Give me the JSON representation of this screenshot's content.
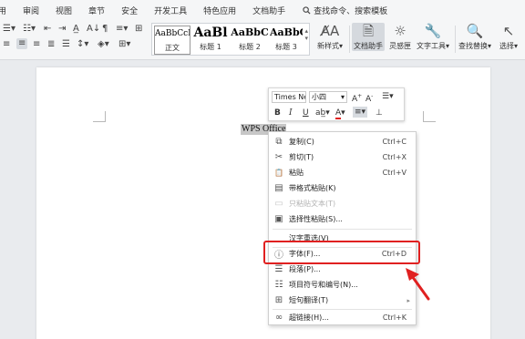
{
  "menu": {
    "tabs": [
      "用",
      "审阅",
      "视图",
      "章节",
      "安全",
      "开发工具",
      "特色应用",
      "文档助手"
    ],
    "search_placeholder": "查找命令、搜索模板"
  },
  "toolbar": {
    "styles": [
      {
        "sample": "AaBbCcI",
        "label": "正文"
      },
      {
        "sample": "AaBl",
        "label": "标题 1"
      },
      {
        "sample": "AaBbC",
        "label": "标题 2"
      },
      {
        "sample": "AaBbC",
        "label": "标题 3"
      }
    ],
    "new_style_label": "新样式",
    "doc_assistant_label": "文档助手",
    "inspiration_label": "灵感匣",
    "text_tools_label": "文字工具",
    "find_replace_label": "查找替换",
    "select_label": "选择"
  },
  "document": {
    "selected_text": "WPS Office"
  },
  "mini_toolbar": {
    "font_name": "Times Ne",
    "font_size": "小四"
  },
  "context_menu": {
    "items": [
      {
        "label": "复制(C)",
        "shortcut": "Ctrl+C",
        "icon": "copy-icon",
        "glyph": "⧉",
        "disabled": false
      },
      {
        "label": "剪切(T)",
        "shortcut": "Ctrl+X",
        "icon": "scissors-icon",
        "glyph": "✂",
        "disabled": false
      },
      {
        "label": "粘贴",
        "shortcut": "Ctrl+V",
        "icon": "paste-icon",
        "glyph": "📋",
        "disabled": false
      },
      {
        "label": "带格式粘贴(K)",
        "shortcut": "",
        "icon": "paste-format-icon",
        "glyph": "▤",
        "disabled": false
      },
      {
        "label": "只粘贴文本(T)",
        "shortcut": "",
        "icon": "paste-text-icon",
        "glyph": "▭",
        "disabled": true
      },
      {
        "label": "选择性粘贴(S)...",
        "shortcut": "",
        "icon": "paste-special-icon",
        "glyph": "▣",
        "disabled": false
      },
      {
        "label": "汉字重选(V)",
        "shortcut": "",
        "icon": "",
        "glyph": "",
        "disabled": false
      },
      {
        "label": "字体(F)...",
        "shortcut": "Ctrl+D",
        "icon": "font-icon",
        "glyph": "ⓘ",
        "disabled": false
      },
      {
        "label": "段落(P)...",
        "shortcut": "",
        "icon": "paragraph-icon",
        "glyph": "☰",
        "disabled": false
      },
      {
        "label": "项目符号和编号(N)...",
        "shortcut": "",
        "icon": "list-icon",
        "glyph": "☷",
        "disabled": false
      },
      {
        "label": "短句翻译(T)",
        "shortcut": "",
        "icon": "translate-icon",
        "glyph": "⊞",
        "disabled": false
      },
      {
        "label": "超链接(H)...",
        "shortcut": "Ctrl+K",
        "icon": "link-icon",
        "glyph": "∞",
        "disabled": false
      }
    ]
  },
  "colors": {
    "highlight": "#e02020",
    "arrow": "#e02020",
    "font_color_underline": "#e02020"
  }
}
